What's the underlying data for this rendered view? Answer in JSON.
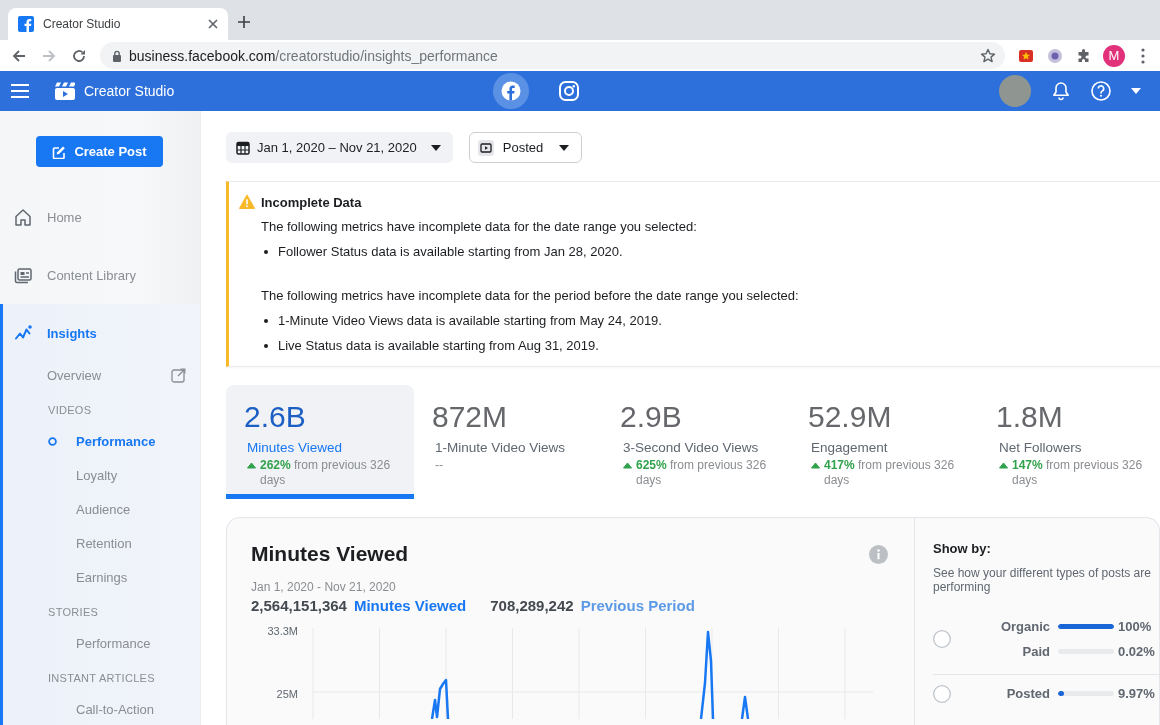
{
  "browser": {
    "tab_title": "Creator Studio",
    "url_host": "business.facebook.com",
    "url_path": "/creatorstudio/insights_performance",
    "profile_initial": "M"
  },
  "app_bar": {
    "title": "Creator Studio",
    "platforms": [
      {
        "kind": "facebook",
        "selected": true
      },
      {
        "kind": "instagram",
        "selected": false
      }
    ]
  },
  "sidebar": {
    "create_button": "Create Post",
    "items": [
      {
        "label": "Home",
        "selected": false
      },
      {
        "label": "Content Library",
        "selected": false
      },
      {
        "label": "Insights",
        "selected": true,
        "children": [
          {
            "kind": "link",
            "label": "Overview",
            "selected": false,
            "external": true
          },
          {
            "kind": "heading",
            "label": "VIDEOS",
            "children": [
              {
                "label": "Performance",
                "selected": true
              },
              {
                "label": "Loyalty",
                "selected": false
              },
              {
                "label": "Audience",
                "selected": false
              },
              {
                "label": "Retention",
                "selected": false
              },
              {
                "label": "Earnings",
                "selected": false
              }
            ]
          },
          {
            "kind": "heading",
            "label": "STORIES",
            "children": [
              {
                "label": "Performance",
                "selected": false
              }
            ]
          },
          {
            "kind": "heading",
            "label": "INSTANT ARTICLES",
            "children": [
              {
                "label": "Call-to-Action",
                "selected": false
              }
            ]
          }
        ]
      }
    ]
  },
  "filters": {
    "date_range": "Jan 1, 2020 – Nov 21, 2020",
    "post_type": "Posted"
  },
  "alert": {
    "title": "Incomplete Data",
    "sections": [
      {
        "text": "The following metrics have incomplete data for the date range you selected:",
        "bullets": [
          "Follower Status data is available starting from Jan 28, 2020."
        ]
      },
      {
        "text": "The following metrics have incomplete data for the period before the date range you selected:",
        "bullets": [
          "1-Minute Video Views data is available starting from May 24, 2019.",
          "Live Status data is available starting from Aug 31, 2019."
        ]
      }
    ]
  },
  "metrics": [
    {
      "value": "2.6B",
      "label": "Minutes Viewed",
      "increase": true,
      "change": "**262%** from previous 326 days",
      "selected": true
    },
    {
      "value": "872M",
      "label": "1-Minute Video Views",
      "increase": false,
      "change": "--",
      "selected": false
    },
    {
      "value": "2.9B",
      "label": "3-Second Video Views",
      "increase": true,
      "change": "**625%** from previous 326 days",
      "selected": false
    },
    {
      "value": "52.9M",
      "label": "Engagement",
      "increase": true,
      "change": "**417%** from previous 326 days",
      "selected": false
    },
    {
      "value": "1.8M",
      "label": "Net Followers",
      "increase": true,
      "change": "**147%** from previous 326 days",
      "selected": false
    }
  ],
  "chart_card": {
    "title": "Minutes Viewed",
    "date_range": "Jan 1, 2020 - Nov 21, 2020",
    "totals": [
      {
        "total": "2,564,151,364",
        "series": "Minutes Viewed",
        "color": "#1877f2"
      },
      {
        "total": "708,289,242",
        "series": "Previous Period",
        "color": "#5c9ae6"
      }
    ],
    "y_axis_labels": [
      "33.3M",
      "25M"
    ]
  },
  "show_by": {
    "title": "Show by:",
    "description": "See how your different types of posts are performing",
    "groups": [
      {
        "selected": false,
        "rows": [
          {
            "label": "Organic",
            "level": 1,
            "value": "100%"
          },
          {
            "label": "Paid",
            "level": 0.0002,
            "value": "0.02%"
          }
        ]
      },
      {
        "selected": false,
        "rows": [
          {
            "label": "Posted",
            "level": 0.0997,
            "value": "9.97%"
          }
        ]
      }
    ]
  }
}
